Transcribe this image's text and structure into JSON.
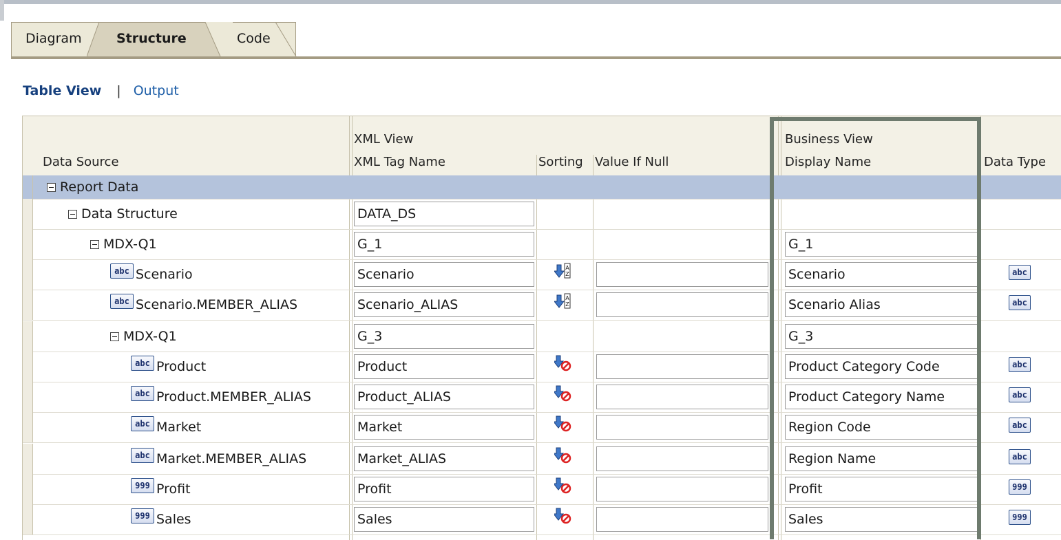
{
  "tabs": [
    {
      "label": "Diagram",
      "active": false
    },
    {
      "label": "Structure",
      "active": true
    },
    {
      "label": "Code",
      "active": false
    }
  ],
  "views": {
    "table_view": "Table View",
    "separator": "|",
    "output": "Output"
  },
  "columns": {
    "data_source": "Data Source",
    "xml_view": "XML View",
    "xml_tag_name": "XML Tag Name",
    "sorting": "Sorting",
    "value_if_null": "Value If Null",
    "business_view": "Business View",
    "display_name": "Display Name",
    "data_type": "Data Type"
  },
  "rows": [
    {
      "label": "Report Data",
      "kind": "group",
      "indent": 0,
      "xml_tag": null,
      "display": null,
      "type": null,
      "sort": null
    },
    {
      "label": "Data Structure",
      "kind": "group",
      "indent": 1,
      "xml_tag": "DATA_DS",
      "display": null,
      "type": null,
      "sort": null
    },
    {
      "label": "MDX-Q1",
      "kind": "group",
      "indent": 2,
      "xml_tag": "G_1",
      "display": "G_1",
      "type": null,
      "sort": null
    },
    {
      "label": "Scenario",
      "kind": "field",
      "indent": 3,
      "type": "abc",
      "xml_tag": "Scenario",
      "display": "Scenario",
      "sort": "az"
    },
    {
      "label": "Scenario.MEMBER_ALIAS",
      "kind": "field",
      "indent": 3,
      "type": "abc",
      "xml_tag": "Scenario_ALIAS",
      "display": "Scenario Alias",
      "sort": "az"
    },
    {
      "label": "MDX-Q1",
      "kind": "group",
      "indent": 3,
      "xml_tag": "G_3",
      "display": "G_3",
      "type": null,
      "sort": null
    },
    {
      "label": "Product",
      "kind": "field",
      "indent": 4,
      "type": "abc",
      "xml_tag": "Product",
      "display": "Product Category Code",
      "sort": "none"
    },
    {
      "label": "Product.MEMBER_ALIAS",
      "kind": "field",
      "indent": 4,
      "type": "abc",
      "xml_tag": "Product_ALIAS",
      "display": "Product Category Name",
      "sort": "none"
    },
    {
      "label": "Market",
      "kind": "field",
      "indent": 4,
      "type": "abc",
      "xml_tag": "Market",
      "display": "Region Code",
      "sort": "none"
    },
    {
      "label": "Market.MEMBER_ALIAS",
      "kind": "field",
      "indent": 4,
      "type": "abc",
      "xml_tag": "Market_ALIAS",
      "display": "Region Name",
      "sort": "none"
    },
    {
      "label": "Profit",
      "kind": "field",
      "indent": 4,
      "type": "999",
      "xml_tag": "Profit",
      "display": "Profit",
      "sort": "none"
    },
    {
      "label": "Sales",
      "kind": "field",
      "indent": 4,
      "type": "999",
      "xml_tag": "Sales",
      "display": "Sales",
      "sort": "none"
    }
  ],
  "colors": {
    "selected_row": "#b4c3dc",
    "highlight_frame": "#6e7b6e",
    "tab_rule": "#a49b83"
  }
}
